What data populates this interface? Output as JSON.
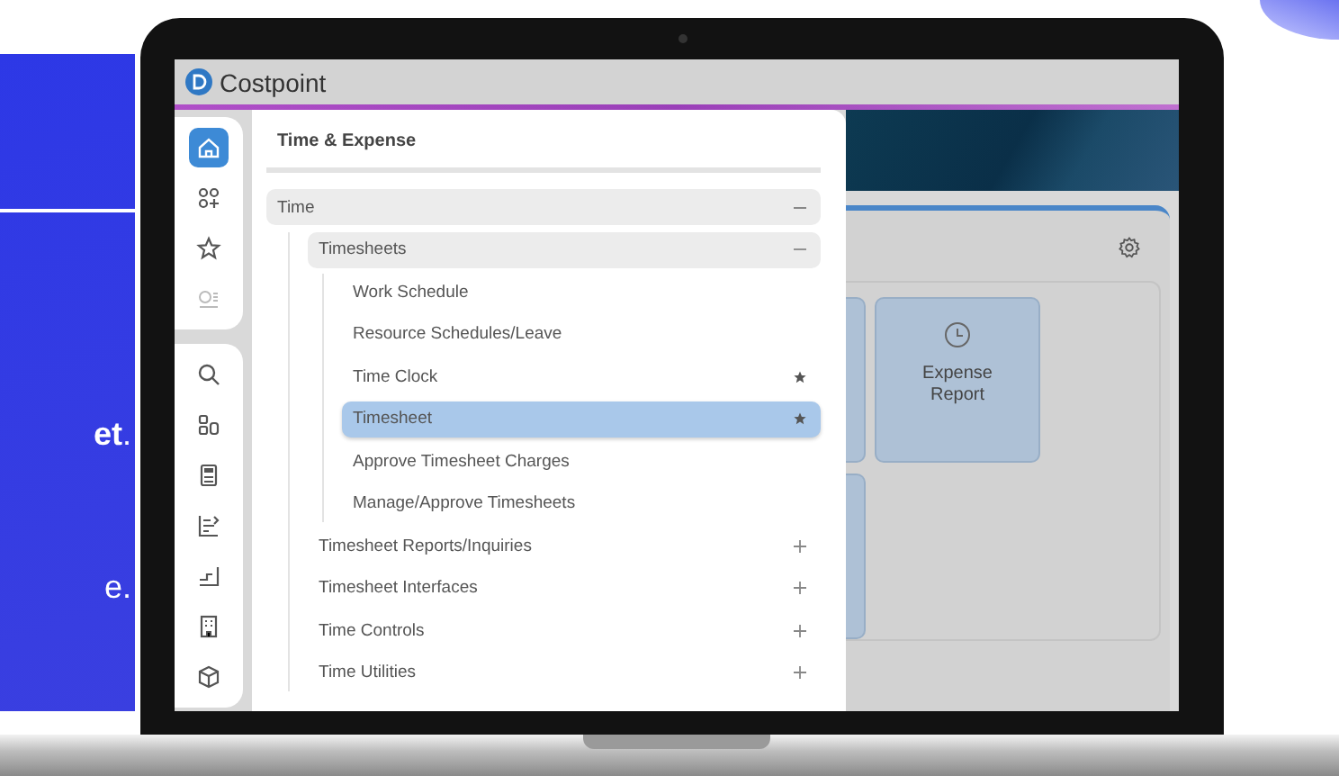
{
  "promo": {
    "texts": [
      "**et**.",
      "e."
    ]
  },
  "app": {
    "title": "Costpoint",
    "rail": {
      "groups": [
        [
          {
            "selected": true,
            "disabled": false
          },
          {
            "selected": false,
            "disabled": false
          },
          {
            "selected": false,
            "disabled": false
          },
          {
            "selected": false,
            "disabled": true
          }
        ],
        [
          {
            "selected": false,
            "disabled": false
          },
          {
            "selected": false,
            "disabled": false
          },
          {
            "selected": false,
            "disabled": false
          },
          {
            "selected": false,
            "disabled": false
          },
          {
            "selected": false,
            "disabled": false
          },
          {
            "selected": false,
            "disabled": false
          },
          {
            "selected": false,
            "disabled": false
          }
        ]
      ]
    },
    "menu": {
      "title": "Time & Expense",
      "tree": [
        {
          "label": "Time",
          "selected": false,
          "expanded": true,
          "children": [
            {
              "label": "Timesheets",
              "selected": false,
              "expanded": true,
              "children": [
                {
                  "label": "Work Schedule",
                  "selected": false,
                  "favorite": false
                },
                {
                  "label": "Resource Schedules/Leave",
                  "selected": false,
                  "favorite": false
                },
                {
                  "label": "Time Clock",
                  "selected": false,
                  "favorite": true
                },
                {
                  "label": "Timesheet",
                  "selected": true,
                  "favorite": true
                },
                {
                  "label": "Approve Timesheet Charges",
                  "selected": false,
                  "favorite": false
                },
                {
                  "label": "Manage/Approve Timesheets",
                  "selected": false,
                  "favorite": false
                }
              ]
            },
            {
              "label": "Timesheet Reports/Inquiries",
              "selected": false,
              "expanded": false
            },
            {
              "label": "Timesheet Interfaces",
              "selected": false,
              "expanded": false
            },
            {
              "label": "Time Controls",
              "selected": false,
              "expanded": false
            },
            {
              "label": "Time Utilities",
              "selected": false,
              "expanded": false
            }
          ]
        }
      ]
    },
    "tiles": [
      {
        "label": "Expense Report"
      }
    ]
  }
}
